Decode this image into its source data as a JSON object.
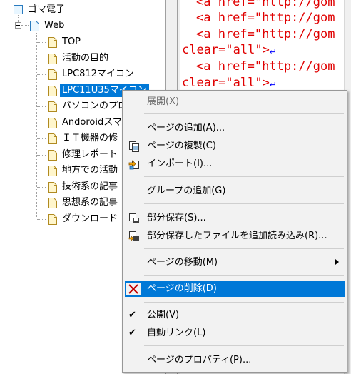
{
  "tree": {
    "root": "ゴマ電子",
    "folder": "Web",
    "pages": [
      "TOP",
      "活動の目的",
      "LPC812マイコン",
      "LPC11U35マイコン",
      "パソコンのプロ",
      "Andoroidスマ",
      "ＩＴ機器の修",
      "修理レポート",
      "地方での活動",
      "技術系の記事",
      "思想系の記事",
      "ダウンロード"
    ],
    "selected_index": 3
  },
  "editor": {
    "lines": [
      {
        "text": "<a href=\"http://gom",
        "lf": false
      },
      {
        "text": "<a href=\"http://gom",
        "lf": false
      },
      {
        "text": "<a href=\"http://gom",
        "lf": false
      },
      {
        "text": "clear=\"all\">",
        "lf": true
      },
      {
        "text": "<a href=\"http://gom",
        "lf": false
      },
      {
        "text": "clear=\"all\">",
        "lf": true
      }
    ],
    "lf_glyph": "↵"
  },
  "menu": {
    "expand": "展開(X)",
    "add_page": "ページの追加(A)...",
    "duplicate_page": "ページの複製(C)",
    "import": "インポート(I)...",
    "add_group": "グループの追加(G)",
    "partial_save": "部分保存(S)...",
    "partial_load": "部分保存したファイルを追加読み込み(R)...",
    "move_page": "ページの移動(M)",
    "delete_page": "ページの削除(D)",
    "publish": "公開(V)",
    "auto_link": "自動リンク(L)",
    "page_properties": "ページのプロパティ(P)...",
    "check_mark": "✔"
  },
  "colors": {
    "selection": "#0078d7",
    "code_text": "#e00000",
    "line_feed": "#0000ff",
    "delete_icon": "#c00000"
  }
}
